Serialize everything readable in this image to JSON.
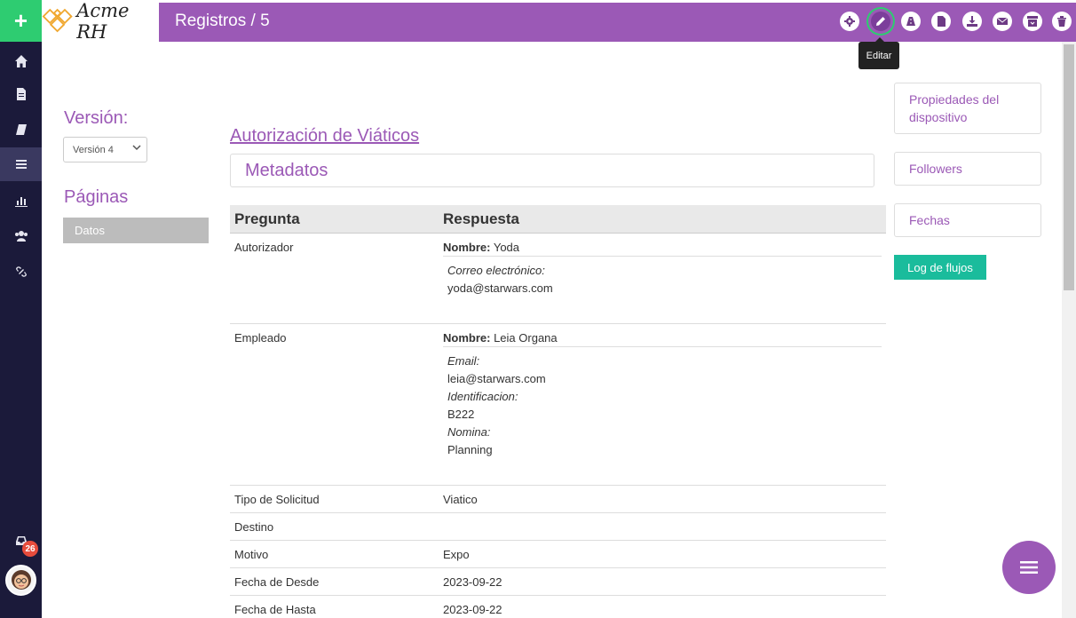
{
  "header": {
    "logo_text": "Acme RH",
    "title": "Registros / 5",
    "tooltip": "Editar",
    "toolbar_icons": [
      "gear-icon",
      "pencil-icon",
      "road-icon",
      "file-icon",
      "download-icon",
      "envelope-icon",
      "archive-icon",
      "trash-icon"
    ]
  },
  "sidebar": {
    "items": [
      "home-icon",
      "document-icon",
      "book-icon",
      "list-icon",
      "chart-icon",
      "users-icon",
      "link-icon"
    ],
    "notification_count": "26"
  },
  "left": {
    "version_label": "Versión:",
    "version_value": "Versión 4",
    "pages_label": "Páginas",
    "pages": [
      "Datos"
    ]
  },
  "main": {
    "form_title": "Autorización de Viáticos",
    "section_title": "Metadatos",
    "columns": [
      "Pregunta",
      "Respuesta"
    ],
    "rows": {
      "autorizador": {
        "question": "Autorizador",
        "name_label": "Nombre:",
        "name_value": "Yoda",
        "f1_label": "Correo electrónico:",
        "f1_value": "yoda@starwars.com"
      },
      "empleado": {
        "question": "Empleado",
        "name_label": "Nombre:",
        "name_value": "Leia Organa",
        "f1_label": "Email:",
        "f1_value": "leia@starwars.com",
        "f2_label": "Identificacion:",
        "f2_value": "B222",
        "f3_label": "Nomina:",
        "f3_value": "Planning"
      },
      "tipo": {
        "question": "Tipo de Solicitud",
        "answer": "Viatico"
      },
      "destino": {
        "question": "Destino",
        "answer": ""
      },
      "motivo": {
        "question": "Motivo",
        "answer": "Expo"
      },
      "desde": {
        "question": "Fecha de Desde",
        "answer": "2023-09-22"
      },
      "hasta": {
        "question": "Fecha de Hasta",
        "answer": "2023-09-22"
      }
    }
  },
  "right": {
    "device_props": "Propiedades del dispositivo",
    "followers": "Followers",
    "dates": "Fechas",
    "log": "Log de flujos"
  },
  "colors": {
    "brand": "#9b59b6",
    "add": "#2ecc71",
    "sidebar": "#1b1a3a",
    "log": "#1abc9c"
  }
}
